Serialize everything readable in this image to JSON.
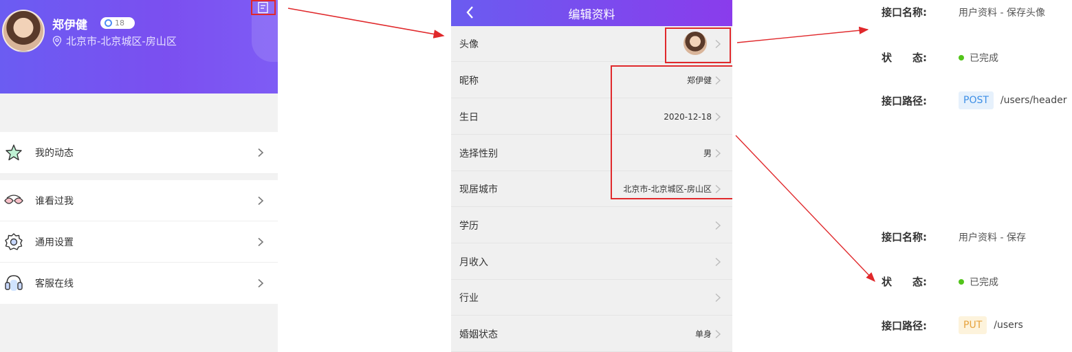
{
  "profile": {
    "name": "郑伊健",
    "level": "18",
    "location": "北京市-北京城区-房山区"
  },
  "menu": [
    {
      "label": "我的动态",
      "icon": "star-icon"
    },
    {
      "label": "谁看过我",
      "icon": "glasses-icon"
    },
    {
      "label": "通用设置",
      "icon": "gear-icon"
    },
    {
      "label": "客服在线",
      "icon": "headset-icon"
    }
  ],
  "edit": {
    "title": "编辑资料",
    "rows": [
      {
        "label": "头像",
        "value": ""
      },
      {
        "label": "昵称",
        "value": "郑伊健"
      },
      {
        "label": "生日",
        "value": "2020-12-18"
      },
      {
        "label": "选择性别",
        "value": "男"
      },
      {
        "label": "现居城市",
        "value": "北京市-北京城区-房山区"
      },
      {
        "label": "学历",
        "value": ""
      },
      {
        "label": "月收入",
        "value": ""
      },
      {
        "label": "行业",
        "value": ""
      },
      {
        "label": "婚姻状态",
        "value": "单身"
      }
    ]
  },
  "apis": [
    {
      "name_key": "接口名称:",
      "name": "用户资料 - 保存头像",
      "status_key": "状　　态:",
      "status": "已完成",
      "path_key": "接口路径:",
      "method": "POST",
      "path": "/users/header"
    },
    {
      "name_key": "接口名称:",
      "name": "用户资料 - 保存",
      "status_key": "状　　态:",
      "status": "已完成",
      "path_key": "接口路径:",
      "method": "PUT",
      "path": "/users"
    }
  ],
  "colors": {
    "accent": "#7b4ff0",
    "highlight": "#e0282b",
    "status_done": "#52c41a"
  }
}
